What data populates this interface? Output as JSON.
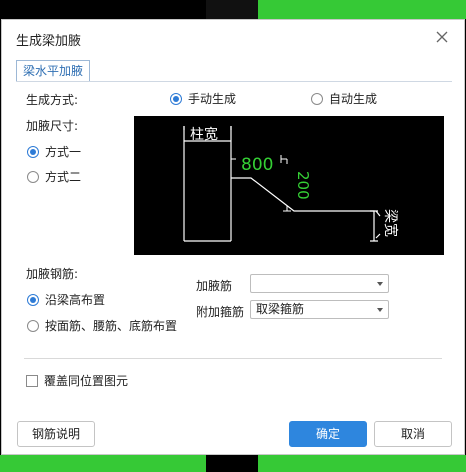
{
  "colors": {
    "accent": "#2e86de",
    "green_strip": "#36c936",
    "diagram_bg": "#000000"
  },
  "dialog": {
    "title": "生成梁加腋",
    "close_icon": "close-icon",
    "tab_label": "梁水平加腋"
  },
  "generation": {
    "label": "生成方式:",
    "manual_label": "手动生成",
    "auto_label": "自动生成",
    "selected": "manual"
  },
  "size": {
    "label": "加腋尺寸:",
    "option1_label": "方式一",
    "option2_label": "方式二",
    "selected": "option1"
  },
  "diagram": {
    "column_width_label": "柱宽",
    "dim_horizontal": "800",
    "dim_vertical": "200",
    "beam_width_label": "梁宽"
  },
  "rebar": {
    "label": "加腋钢筋:",
    "option1_label": "沿梁高布置",
    "option2_label": "按面筋、腰筋、底筋布置",
    "selected": "option1",
    "haunch_rebar_label": "加腋筋",
    "haunch_rebar_value": "",
    "stirrup_label": "附加箍筋",
    "stirrup_value": "取梁箍筋"
  },
  "overwrite": {
    "label": "覆盖同位置图元",
    "checked": false
  },
  "buttons": {
    "help_label": "钢筋说明",
    "ok_label": "确定",
    "cancel_label": "取消"
  }
}
